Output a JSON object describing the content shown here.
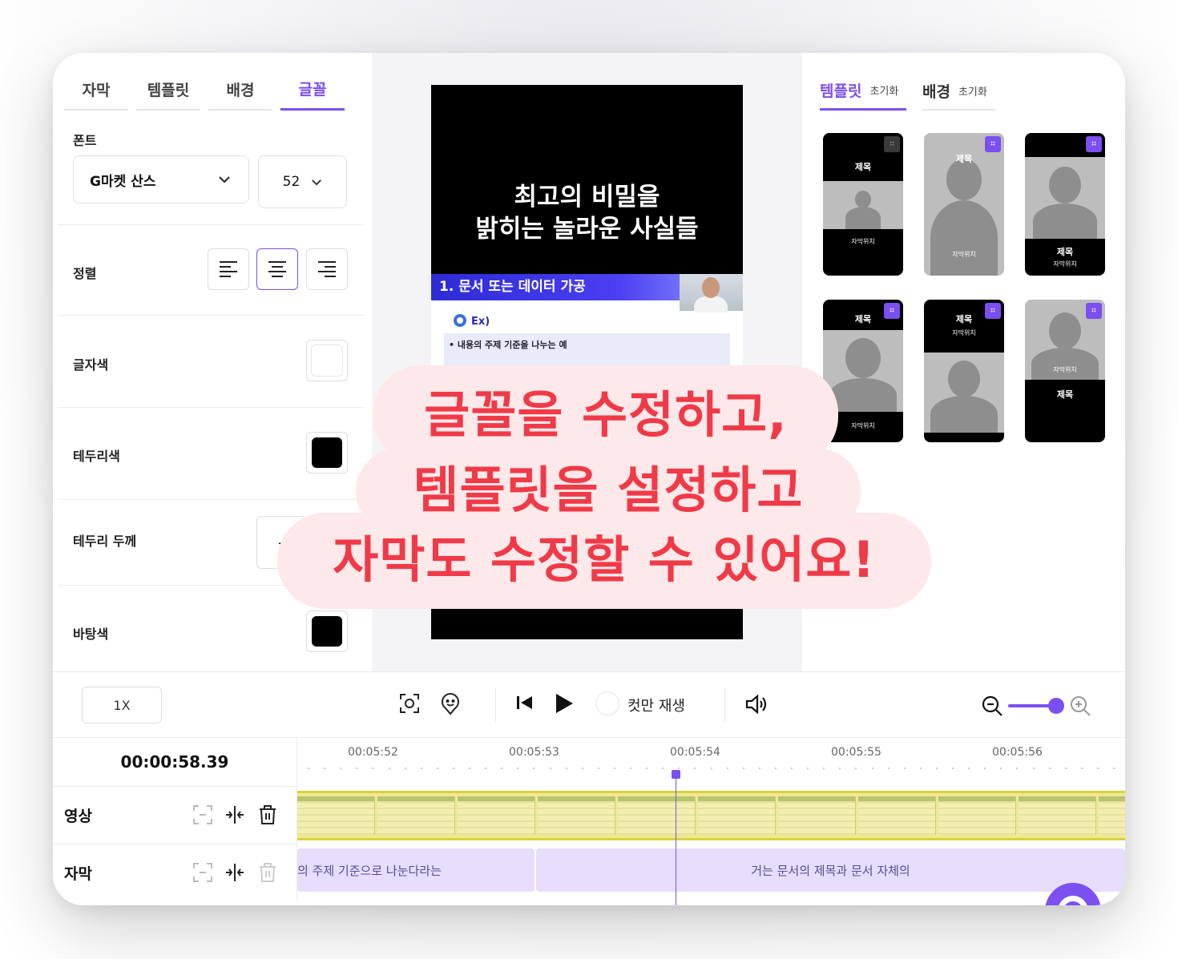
{
  "left_panel": {
    "tabs": [
      "자막",
      "템플릿",
      "배경",
      "글꼴"
    ],
    "active_tab": "글꼴",
    "font_label": "폰트",
    "font_value": "G마켓 산스",
    "size_value": "52",
    "align_label": "정렬",
    "text_color_label": "글자색",
    "border_color_label": "테두리색",
    "border_width_label": "테두리 두께",
    "stepper_minus": "-",
    "bg_color_label": "바탕색",
    "colors": {
      "text": "#ffffff",
      "border": "#000000",
      "background": "#000000"
    }
  },
  "preview": {
    "title_line1": "최고의 비밀을",
    "title_line2": "밝히는 놀라운 사실들",
    "slide_heading": "1. 문서 또는 데이터 가공",
    "slide_ex": "Ex)",
    "slide_bullet": "• 내용의 주제 기준을 나누는 예"
  },
  "right_panel": {
    "tabs": [
      {
        "label": "템플릿",
        "reset": "초기화",
        "active": true
      },
      {
        "label": "배경",
        "reset": "초기화",
        "active": false
      }
    ],
    "thumb_title": "제목",
    "thumb_sub": "자막위치"
  },
  "controls": {
    "speed": "1X",
    "cut_play_label": "컷만 재생"
  },
  "timeline": {
    "current_time": "00:00:58.39",
    "ticks": [
      "00:05:52",
      "00:05:53",
      "00:05:54",
      "00:05:55",
      "00:05:56"
    ],
    "tracks": [
      "영상",
      "자막"
    ],
    "subtitle_clips": [
      "의 주제 기준으로 나눈다라는",
      "거는 문서의 제목과 문서 자체의"
    ]
  },
  "overlay": {
    "line1": "글꼴을 수정하고,",
    "line2": "템플릿을 설정하고",
    "line3": "자막도 수정할 수 있어요!"
  },
  "accent_color": "#7b4ff0",
  "overlay_text_color": "#f03a47"
}
